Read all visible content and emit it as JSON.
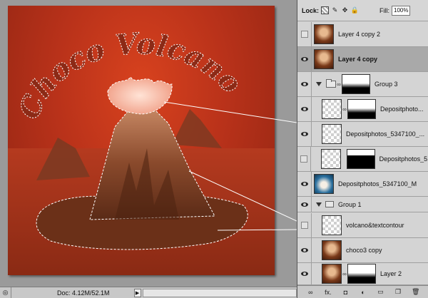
{
  "status": {
    "doc_info": "Doc: 4.12M/52.1M"
  },
  "lockbar": {
    "lock_label": "Lock:",
    "fill_label": "Fill:",
    "fill_value": "100%"
  },
  "layers": [
    {
      "name": "Layer 4 copy 2",
      "visible": false,
      "thumb": "choco",
      "selected": false
    },
    {
      "name": "Layer 4 copy",
      "visible": true,
      "thumb": "choco",
      "selected": true
    },
    {
      "name": "Group 3",
      "visible": true,
      "kind": "group",
      "mask": "grad"
    },
    {
      "name": "Depositphoto...",
      "visible": true,
      "thumb": "checker",
      "mask": "grad"
    },
    {
      "name": "Depositphotos_5347100_...",
      "visible": true,
      "thumb": "checker"
    },
    {
      "name": "Depositphotos_5...",
      "visible": false,
      "thumb": "checker",
      "mask": "blackwhite"
    },
    {
      "name": "Depositphotos_5347100_M",
      "visible": true,
      "thumb": "blue"
    },
    {
      "name": "Group 1",
      "visible": true,
      "kind": "group"
    },
    {
      "name": "volcano&textcontour",
      "visible": false,
      "thumb": "checker"
    },
    {
      "name": "choco3 copy",
      "visible": true,
      "thumb": "choco"
    },
    {
      "name": "Layer 2",
      "visible": true,
      "thumb": "choco",
      "mask": "grad"
    }
  ],
  "footer": {
    "fx_label": "fx."
  },
  "artwork": {
    "title": "Choco Volcano"
  },
  "colors": {
    "panel": "#d4d4d4",
    "selected": "#a9a9a9",
    "canvas_bg": "#c9361b"
  }
}
